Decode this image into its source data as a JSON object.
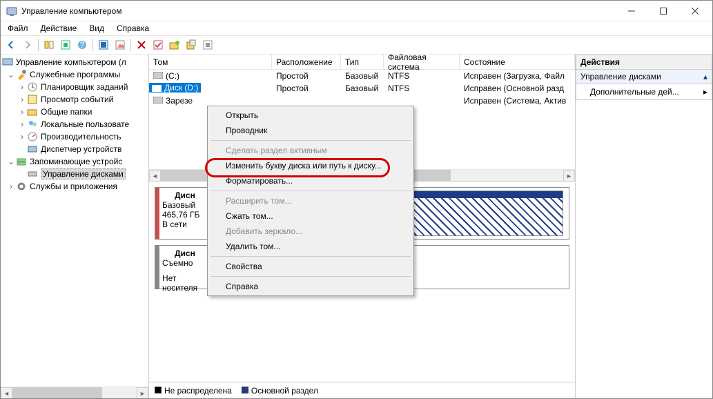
{
  "window": {
    "title": "Управление компьютером"
  },
  "menu": {
    "file": "Файл",
    "action": "Действие",
    "view": "Вид",
    "help": "Справка"
  },
  "tree": {
    "root": "Управление компьютером (л",
    "sys_tools": "Служебные программы",
    "scheduler": "Планировщик заданий",
    "events": "Просмотр событий",
    "shared": "Общие папки",
    "users": "Локальные пользовате",
    "perf": "Производительность",
    "devmgr": "Диспетчер устройств",
    "storage": "Запоминающие устройс",
    "diskmgmt": "Управление дисками",
    "services": "Службы и приложения"
  },
  "columns": {
    "vol": "Том",
    "layout": "Расположение",
    "type": "Тип",
    "fs": "Файловая система",
    "status": "Состояние"
  },
  "vols": {
    "c_name": "(C:)",
    "c_layout": "Простой",
    "c_type": "Базовый",
    "c_fs": "NTFS",
    "c_status": "Исправен (Загрузка, Файл",
    "d_name": "Диск (D:)",
    "d_layout": "Простой",
    "d_type": "Базовый",
    "d_fs": "NTFS",
    "d_status": "Исправен (Основной разд",
    "r_name": "Зарезе",
    "r_status": "Исправен (Система, Актив"
  },
  "graphic": {
    "disk0_title": "Дисн",
    "disk0_type": "Базовый",
    "disk0_size": "465,76 ГБ",
    "disk0_state": "В сети",
    "disk1_title": "Дисн",
    "disk1_type": "Съемно",
    "disk1_empty": "Нет носителя"
  },
  "legend": {
    "unalloc": "Не распределена",
    "primary": "Основной раздел"
  },
  "actions": {
    "header": "Действия",
    "diskmgmt": "Управление дисками",
    "more": "Дополнительные дей..."
  },
  "ctx": {
    "open": "Открыть",
    "explorer": "Проводник",
    "active": "Сделать раздел активным",
    "letter": "Изменить букву диска или путь к диску...",
    "format": "Форматировать...",
    "extend": "Расширить том...",
    "shrink": "Сжать том...",
    "mirror": "Добавить зеркало...",
    "delete": "Удалить том...",
    "props": "Свойства",
    "help": "Справка"
  }
}
